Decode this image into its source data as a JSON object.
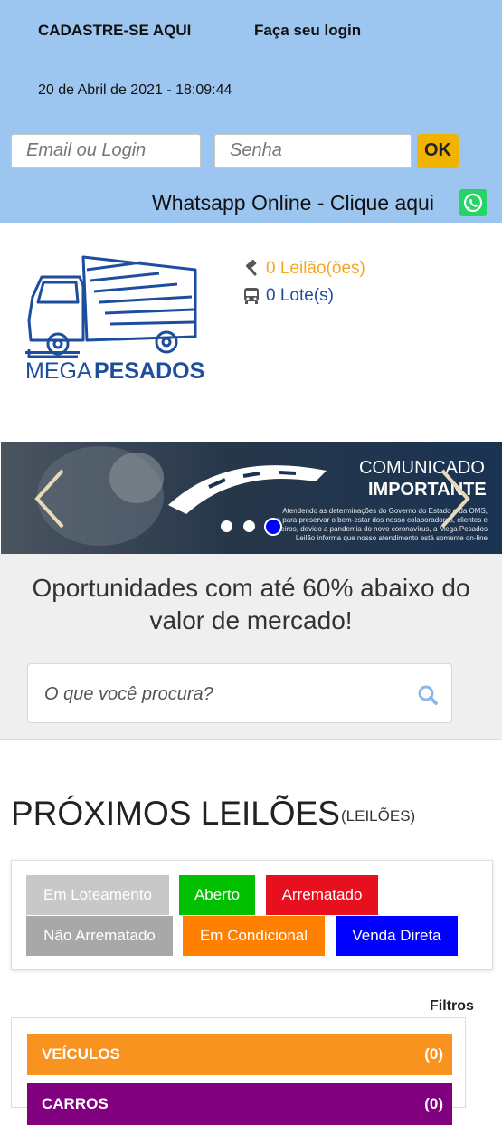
{
  "header": {
    "register_link": "CADASTRE-SE AQUI",
    "login_link": "Faça seu login",
    "datetime": "20 de Abril de 2021 - 18:09:44",
    "email_placeholder": "Email ou Login",
    "password_placeholder": "Senha",
    "ok_label": "OK",
    "whatsapp_text": "Whatsapp Online - Clique aqui"
  },
  "brand": {
    "logo_text_light": "MEGA",
    "logo_text_bold": "PESADOS"
  },
  "stats": {
    "auctions": "0 Leilão(ões)",
    "lots": "0 Lote(s)"
  },
  "banner": {
    "title_light": "COMUNICADO",
    "title_bold": "IMPORTANTE",
    "body_line1": "Atendendo as determinações do Governo do Estado e da OMS,",
    "body_line2": "e para preservar o bem-estar dos nosso colaboradores, clientes e",
    "body_line3": "parceiros, devido a pandemia do novo coronavírus, a Mega Pesados",
    "body_line4": "Leilão informa que nosso atendimento está somente on-line",
    "slide_count": 3,
    "active_slide": 3
  },
  "hero": {
    "title": "Oportunidades com até 60% abaixo do valor de mercado!",
    "search_placeholder": "O que você procura?"
  },
  "section": {
    "title": "PRÓXIMOS LEILÕES",
    "subtitle": "(LEILÕES)"
  },
  "status_legend": [
    {
      "label": "Em Loteamento",
      "color": "#c8c8c8"
    },
    {
      "label": "Aberto",
      "color": "#00c000"
    },
    {
      "label": "Arrematado",
      "color": "#e8101e"
    },
    {
      "label": "Não Arrematado",
      "color": "#a8a8a8"
    },
    {
      "label": "Em Condicional",
      "color": "#ff7f00"
    },
    {
      "label": "Venda Direta",
      "color": "#0000ff"
    }
  ],
  "filters": {
    "title": "Filtros",
    "categories": [
      {
        "name": "VEÍCULOS",
        "count": "(0)",
        "color": "#f7931e"
      },
      {
        "name": "CARROS",
        "count": "(0)",
        "color": "#800080"
      }
    ]
  },
  "colors": {
    "header_bg": "#9cc5ef",
    "accent_yellow": "#f0b400",
    "auction_orange": "#f5a623",
    "lots_blue": "#1d4e9e"
  }
}
